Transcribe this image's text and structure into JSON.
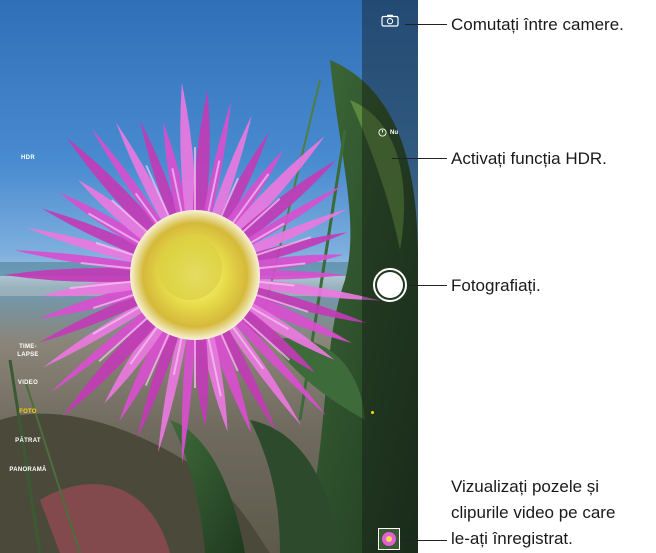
{
  "camera_controls": {
    "timer_value": "Nu",
    "hdr_label": "HDR",
    "modes": [
      "TIME-",
      "LAPSE",
      "VIDEO",
      "FOTO",
      "PĂTRAT",
      "PANORAMĂ"
    ],
    "active_mode": "FOTO",
    "accent_color": "#ffd60a"
  },
  "callouts": {
    "switch_cameras": "Comutați între camere.",
    "hdr": "Activați funcția HDR.",
    "take_photo": "Fotografiați.",
    "view_line1": "Vizualizați pozele și",
    "view_line2": "clipurile video pe care",
    "view_line3": "le-ați înregistrat."
  },
  "icons": {
    "camera_switch": "camera-switch-icon",
    "timer": "timer-icon",
    "shutter": "shutter-button",
    "thumbnail": "photo-thumbnail"
  }
}
